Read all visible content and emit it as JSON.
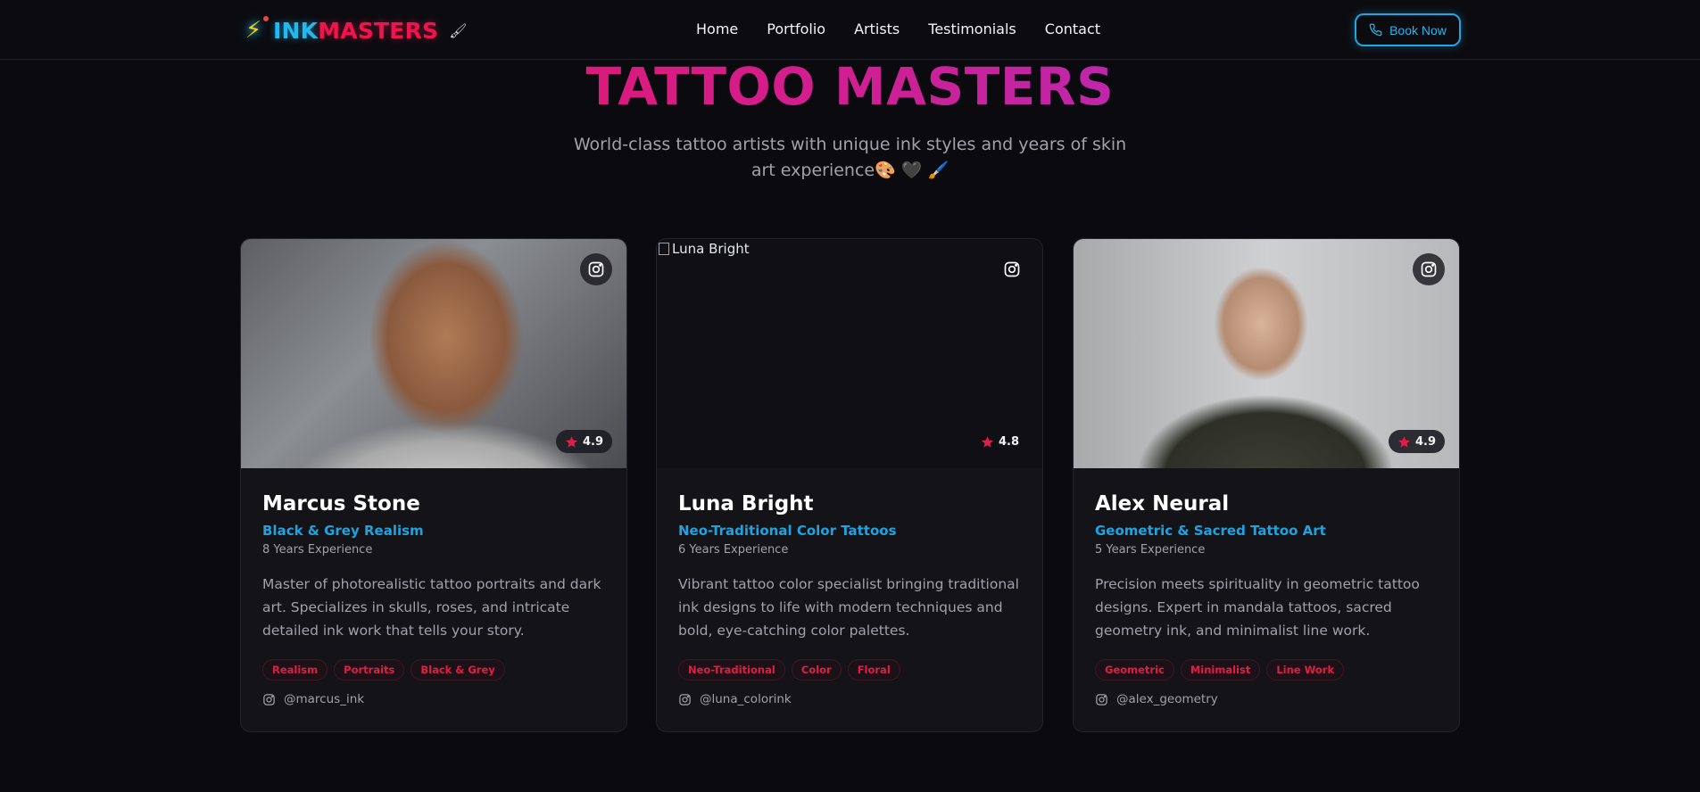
{
  "brand": {
    "ink": "INK",
    "masters": "MASTERS"
  },
  "nav": {
    "links": [
      "Home",
      "Portfolio",
      "Artists",
      "Testimonials",
      "Contact"
    ],
    "cta": "Book Now"
  },
  "hero": {
    "title": "TATTOO MASTERS",
    "subtitle": "World-class tattoo artists with unique ink styles and years of skin art experience🎨 🖤 🖌️"
  },
  "artists": [
    {
      "name": "Marcus Stone",
      "style": "Black & Grey Realism",
      "experience": "8 Years Experience",
      "description": "Master of photorealistic tattoo portraits and dark art. Specializes in skulls, roses, and intricate detailed ink work that tells your story.",
      "tags": [
        "Realism",
        "Portraits",
        "Black & Grey"
      ],
      "instagram": "@marcus_ink",
      "rating": "4.9",
      "image_alt": ""
    },
    {
      "name": "Luna Bright",
      "style": "Neo-Traditional Color Tattoos",
      "experience": "6 Years Experience",
      "description": "Vibrant tattoo color specialist bringing traditional ink designs to life with modern techniques and bold, eye-catching color palettes.",
      "tags": [
        "Neo-Traditional",
        "Color",
        "Floral"
      ],
      "instagram": "@luna_colorink",
      "rating": "4.8",
      "image_alt": "Luna Bright"
    },
    {
      "name": "Alex Neural",
      "style": "Geometric & Sacred Tattoo Art",
      "experience": "5 Years Experience",
      "description": "Precision meets spirituality in geometric tattoo designs. Expert in mandala tattoos, sacred geometry ink, and minimalist line work.",
      "tags": [
        "Geometric",
        "Minimalist",
        "Line Work"
      ],
      "instagram": "@alex_geometry",
      "rating": "4.9",
      "image_alt": ""
    }
  ],
  "colors": {
    "background": "#0b0b0f",
    "accent_blue": "#1fa3e0",
    "accent_red": "#f0134d",
    "accent_purple": "#9b36e0",
    "star": "#e11d48"
  },
  "icons": {
    "logo": "lightning-bolt-icon",
    "book": "phone-icon",
    "social": "instagram-icon",
    "rating": "star-icon",
    "brush": "brush-icon"
  }
}
